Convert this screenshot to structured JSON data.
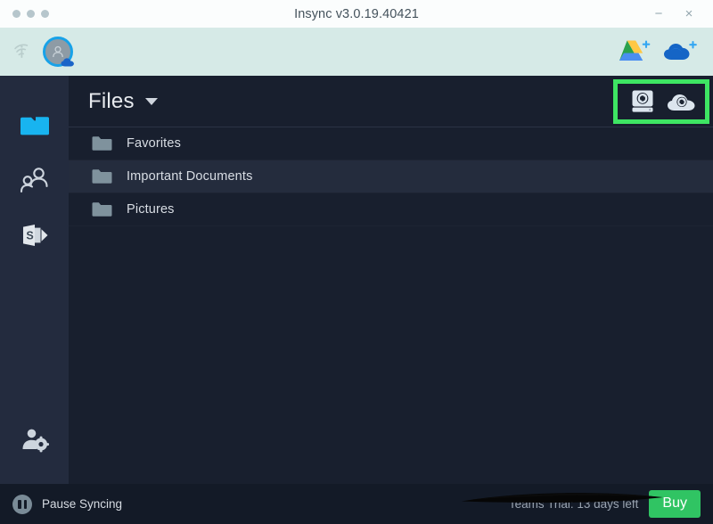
{
  "window": {
    "title": "Insync v3.0.19.40421",
    "dots_icon": "window-dots-icon",
    "minimize_label": "−",
    "close_label": "×"
  },
  "account_bar": {
    "connection_icon": "wifi-info-icon",
    "avatar_icon": "user-avatar-icon",
    "add_google_drive_icon": "google-drive-add-icon",
    "add_onedrive_icon": "onedrive-add-icon"
  },
  "sidebar": {
    "items": [
      {
        "name": "sidebar-item-files",
        "icon": "folder-icon",
        "active": true
      },
      {
        "name": "sidebar-item-shared",
        "icon": "people-shared-icon",
        "active": false
      },
      {
        "name": "sidebar-item-sharepoint",
        "icon": "sharepoint-icon",
        "active": false
      }
    ],
    "bottom_item": {
      "name": "sidebar-item-account-settings",
      "icon": "user-gear-icon"
    }
  },
  "files_header": {
    "title": "Files",
    "caret_icon": "chevron-down-icon",
    "actions": [
      {
        "name": "local-sync-button",
        "icon": "drive-sync-icon"
      },
      {
        "name": "cloud-sync-button",
        "icon": "cloud-sync-icon"
      }
    ],
    "highlight_color": "#3ee563"
  },
  "file_list": {
    "rows": [
      {
        "name": "Favorites",
        "icon": "folder-icon",
        "selected": false
      },
      {
        "name": "Important Documents",
        "icon": "folder-icon",
        "selected": true
      },
      {
        "name": "Pictures",
        "icon": "folder-icon",
        "selected": false
      }
    ]
  },
  "status_bar": {
    "pause_label": "Pause Syncing",
    "pause_icon": "pause-circle-icon",
    "trial_label": "Teams Trial: 13 days left",
    "buy_label": "Buy",
    "buy_color": "#30c463",
    "redaction_icon": "redaction-scribble"
  }
}
